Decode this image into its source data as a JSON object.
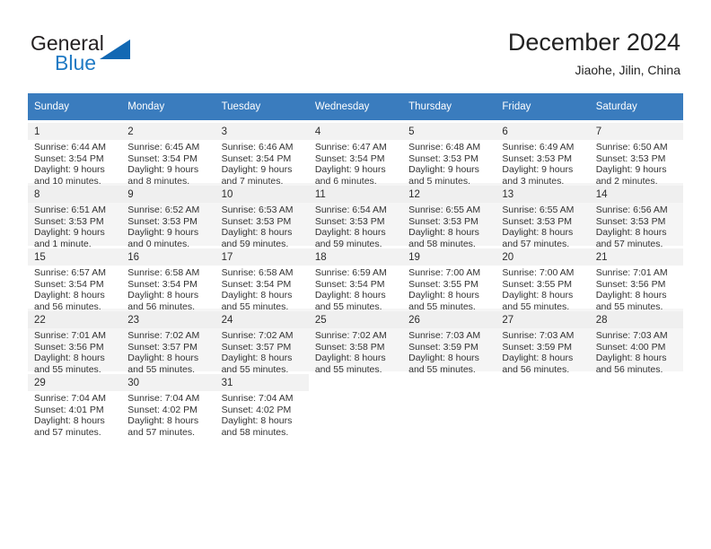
{
  "brand": {
    "line1": "General",
    "line2": "Blue",
    "mark": "triangle-logo"
  },
  "header": {
    "title": "December 2024",
    "subtitle": "Jiaohe, Jilin, China"
  },
  "calendar": {
    "accent_color": "#3a7cbe",
    "weekday_headers": [
      "Sunday",
      "Monday",
      "Tuesday",
      "Wednesday",
      "Thursday",
      "Friday",
      "Saturday"
    ],
    "weeks": [
      [
        {
          "day": "1",
          "sunrise": "Sunrise: 6:44 AM",
          "sunset": "Sunset: 3:54 PM",
          "daylight1": "Daylight: 9 hours",
          "daylight2": "and 10 minutes."
        },
        {
          "day": "2",
          "sunrise": "Sunrise: 6:45 AM",
          "sunset": "Sunset: 3:54 PM",
          "daylight1": "Daylight: 9 hours",
          "daylight2": "and 8 minutes."
        },
        {
          "day": "3",
          "sunrise": "Sunrise: 6:46 AM",
          "sunset": "Sunset: 3:54 PM",
          "daylight1": "Daylight: 9 hours",
          "daylight2": "and 7 minutes."
        },
        {
          "day": "4",
          "sunrise": "Sunrise: 6:47 AM",
          "sunset": "Sunset: 3:54 PM",
          "daylight1": "Daylight: 9 hours",
          "daylight2": "and 6 minutes."
        },
        {
          "day": "5",
          "sunrise": "Sunrise: 6:48 AM",
          "sunset": "Sunset: 3:53 PM",
          "daylight1": "Daylight: 9 hours",
          "daylight2": "and 5 minutes."
        },
        {
          "day": "6",
          "sunrise": "Sunrise: 6:49 AM",
          "sunset": "Sunset: 3:53 PM",
          "daylight1": "Daylight: 9 hours",
          "daylight2": "and 3 minutes."
        },
        {
          "day": "7",
          "sunrise": "Sunrise: 6:50 AM",
          "sunset": "Sunset: 3:53 PM",
          "daylight1": "Daylight: 9 hours",
          "daylight2": "and 2 minutes."
        }
      ],
      [
        {
          "day": "8",
          "sunrise": "Sunrise: 6:51 AM",
          "sunset": "Sunset: 3:53 PM",
          "daylight1": "Daylight: 9 hours",
          "daylight2": "and 1 minute."
        },
        {
          "day": "9",
          "sunrise": "Sunrise: 6:52 AM",
          "sunset": "Sunset: 3:53 PM",
          "daylight1": "Daylight: 9 hours",
          "daylight2": "and 0 minutes."
        },
        {
          "day": "10",
          "sunrise": "Sunrise: 6:53 AM",
          "sunset": "Sunset: 3:53 PM",
          "daylight1": "Daylight: 8 hours",
          "daylight2": "and 59 minutes."
        },
        {
          "day": "11",
          "sunrise": "Sunrise: 6:54 AM",
          "sunset": "Sunset: 3:53 PM",
          "daylight1": "Daylight: 8 hours",
          "daylight2": "and 59 minutes."
        },
        {
          "day": "12",
          "sunrise": "Sunrise: 6:55 AM",
          "sunset": "Sunset: 3:53 PM",
          "daylight1": "Daylight: 8 hours",
          "daylight2": "and 58 minutes."
        },
        {
          "day": "13",
          "sunrise": "Sunrise: 6:55 AM",
          "sunset": "Sunset: 3:53 PM",
          "daylight1": "Daylight: 8 hours",
          "daylight2": "and 57 minutes."
        },
        {
          "day": "14",
          "sunrise": "Sunrise: 6:56 AM",
          "sunset": "Sunset: 3:53 PM",
          "daylight1": "Daylight: 8 hours",
          "daylight2": "and 57 minutes."
        }
      ],
      [
        {
          "day": "15",
          "sunrise": "Sunrise: 6:57 AM",
          "sunset": "Sunset: 3:54 PM",
          "daylight1": "Daylight: 8 hours",
          "daylight2": "and 56 minutes."
        },
        {
          "day": "16",
          "sunrise": "Sunrise: 6:58 AM",
          "sunset": "Sunset: 3:54 PM",
          "daylight1": "Daylight: 8 hours",
          "daylight2": "and 56 minutes."
        },
        {
          "day": "17",
          "sunrise": "Sunrise: 6:58 AM",
          "sunset": "Sunset: 3:54 PM",
          "daylight1": "Daylight: 8 hours",
          "daylight2": "and 55 minutes."
        },
        {
          "day": "18",
          "sunrise": "Sunrise: 6:59 AM",
          "sunset": "Sunset: 3:54 PM",
          "daylight1": "Daylight: 8 hours",
          "daylight2": "and 55 minutes."
        },
        {
          "day": "19",
          "sunrise": "Sunrise: 7:00 AM",
          "sunset": "Sunset: 3:55 PM",
          "daylight1": "Daylight: 8 hours",
          "daylight2": "and 55 minutes."
        },
        {
          "day": "20",
          "sunrise": "Sunrise: 7:00 AM",
          "sunset": "Sunset: 3:55 PM",
          "daylight1": "Daylight: 8 hours",
          "daylight2": "and 55 minutes."
        },
        {
          "day": "21",
          "sunrise": "Sunrise: 7:01 AM",
          "sunset": "Sunset: 3:56 PM",
          "daylight1": "Daylight: 8 hours",
          "daylight2": "and 55 minutes."
        }
      ],
      [
        {
          "day": "22",
          "sunrise": "Sunrise: 7:01 AM",
          "sunset": "Sunset: 3:56 PM",
          "daylight1": "Daylight: 8 hours",
          "daylight2": "and 55 minutes."
        },
        {
          "day": "23",
          "sunrise": "Sunrise: 7:02 AM",
          "sunset": "Sunset: 3:57 PM",
          "daylight1": "Daylight: 8 hours",
          "daylight2": "and 55 minutes."
        },
        {
          "day": "24",
          "sunrise": "Sunrise: 7:02 AM",
          "sunset": "Sunset: 3:57 PM",
          "daylight1": "Daylight: 8 hours",
          "daylight2": "and 55 minutes."
        },
        {
          "day": "25",
          "sunrise": "Sunrise: 7:02 AM",
          "sunset": "Sunset: 3:58 PM",
          "daylight1": "Daylight: 8 hours",
          "daylight2": "and 55 minutes."
        },
        {
          "day": "26",
          "sunrise": "Sunrise: 7:03 AM",
          "sunset": "Sunset: 3:59 PM",
          "daylight1": "Daylight: 8 hours",
          "daylight2": "and 55 minutes."
        },
        {
          "day": "27",
          "sunrise": "Sunrise: 7:03 AM",
          "sunset": "Sunset: 3:59 PM",
          "daylight1": "Daylight: 8 hours",
          "daylight2": "and 56 minutes."
        },
        {
          "day": "28",
          "sunrise": "Sunrise: 7:03 AM",
          "sunset": "Sunset: 4:00 PM",
          "daylight1": "Daylight: 8 hours",
          "daylight2": "and 56 minutes."
        }
      ],
      [
        {
          "day": "29",
          "sunrise": "Sunrise: 7:04 AM",
          "sunset": "Sunset: 4:01 PM",
          "daylight1": "Daylight: 8 hours",
          "daylight2": "and 57 minutes."
        },
        {
          "day": "30",
          "sunrise": "Sunrise: 7:04 AM",
          "sunset": "Sunset: 4:02 PM",
          "daylight1": "Daylight: 8 hours",
          "daylight2": "and 57 minutes."
        },
        {
          "day": "31",
          "sunrise": "Sunrise: 7:04 AM",
          "sunset": "Sunset: 4:02 PM",
          "daylight1": "Daylight: 8 hours",
          "daylight2": "and 58 minutes."
        },
        {
          "day": "",
          "sunrise": "",
          "sunset": "",
          "daylight1": "",
          "daylight2": ""
        },
        {
          "day": "",
          "sunrise": "",
          "sunset": "",
          "daylight1": "",
          "daylight2": ""
        },
        {
          "day": "",
          "sunrise": "",
          "sunset": "",
          "daylight1": "",
          "daylight2": ""
        },
        {
          "day": "",
          "sunrise": "",
          "sunset": "",
          "daylight1": "",
          "daylight2": ""
        }
      ]
    ]
  }
}
